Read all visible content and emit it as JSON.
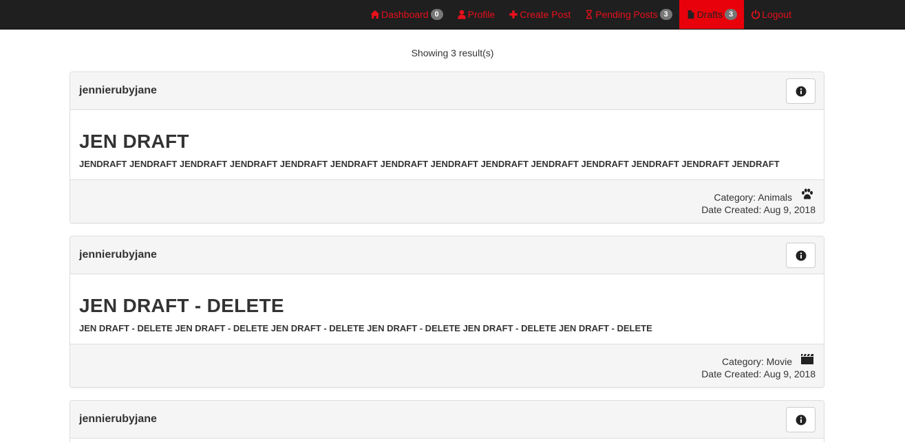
{
  "nav": {
    "items": [
      {
        "label": "Dashboard",
        "icon": "home-icon",
        "badge": "0"
      },
      {
        "label": "Profile",
        "icon": "user-icon"
      },
      {
        "label": "Create Post",
        "icon": "plus-icon"
      },
      {
        "label": "Pending Posts",
        "icon": "hourglass-icon",
        "badge": "3"
      },
      {
        "label": "Drafts",
        "icon": "file-icon",
        "badge": "3",
        "active": true
      },
      {
        "label": "Logout",
        "icon": "power-icon"
      }
    ],
    "colors": {
      "bar": "#1f1f1f",
      "link": "#e8101c",
      "active_bg": "#e8000b"
    }
  },
  "results": {
    "text": "Showing 3 result(s)"
  },
  "posts": [
    {
      "author": "jennierubyjane",
      "title": "JEN DRAFT",
      "text": "JENDRAFT JENDRAFT JENDRAFT JENDRAFT JENDRAFT JENDRAFT JENDRAFT JENDRAFT JENDRAFT JENDRAFT JENDRAFT JENDRAFT JENDRAFT JENDRAFT",
      "category_label": "Category:",
      "category": "Animals",
      "category_icon": "paw-icon",
      "date_label": "Date Created:",
      "date": "Aug 9, 2018"
    },
    {
      "author": "jennierubyjane",
      "title": "JEN DRAFT - DELETE",
      "text": "JEN DRAFT - DELETE JEN DRAFT - DELETE JEN DRAFT - DELETE JEN DRAFT - DELETE JEN DRAFT - DELETE JEN DRAFT - DELETE",
      "category_label": "Category:",
      "category": "Movie",
      "category_icon": "clapperboard-icon",
      "date_label": "Date Created:",
      "date": "Aug 9, 2018"
    },
    {
      "author": "jennierubyjane"
    }
  ]
}
